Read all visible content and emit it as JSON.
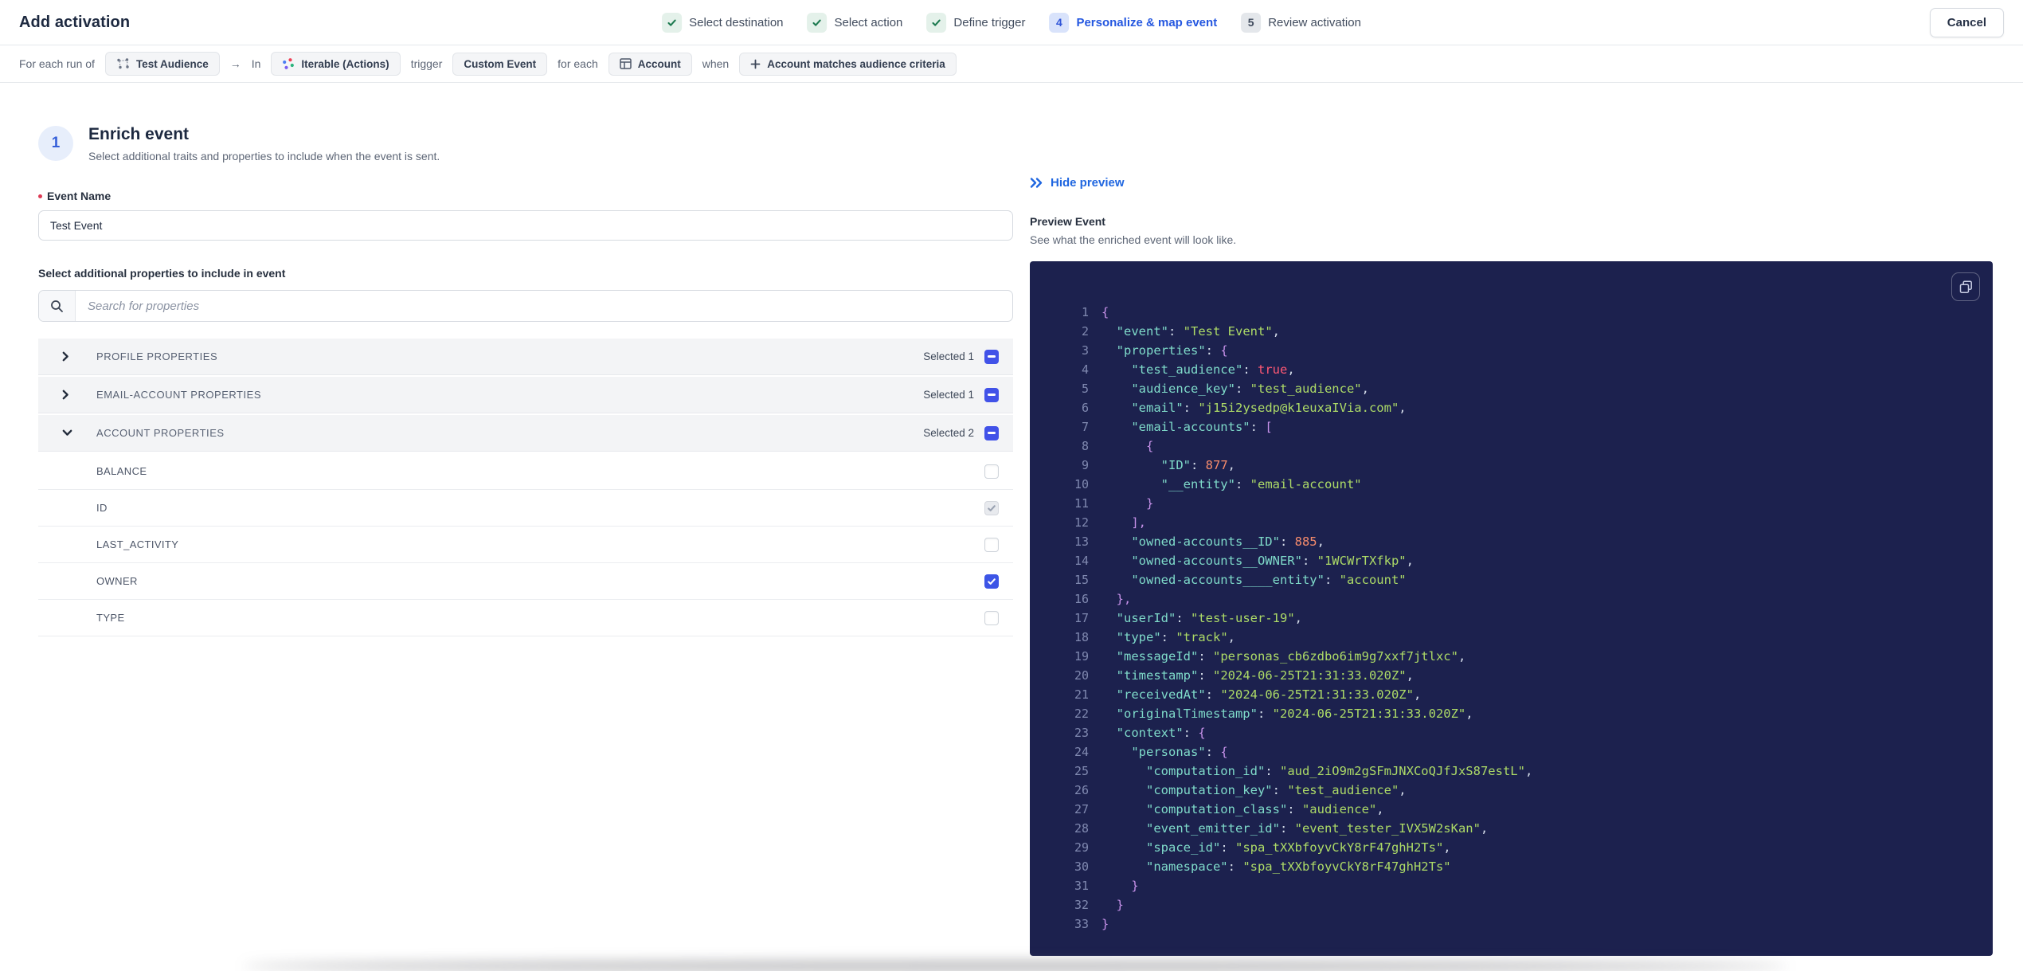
{
  "colors": {
    "accent_blue": "#2457e0",
    "checkbox_blue": "#3d55e6",
    "success_green": "#1d7a50",
    "code_background": "#1c214e",
    "code_key": "#7fdbca",
    "code_string": "#addb67",
    "code_number": "#f78c6c",
    "code_boolean": "#ff5874",
    "code_brace": "#c792ea"
  },
  "header": {
    "title": "Add activation",
    "cancel_label": "Cancel",
    "steps": [
      {
        "label": "Select destination",
        "state": "done",
        "icon": "check-icon"
      },
      {
        "label": "Select action",
        "state": "done",
        "icon": "check-icon"
      },
      {
        "label": "Define trigger",
        "state": "done",
        "icon": "check-icon"
      },
      {
        "label": "Personalize & map event",
        "state": "active",
        "number": "4"
      },
      {
        "label": "Review activation",
        "state": "upcoming",
        "number": "5"
      }
    ]
  },
  "summary": {
    "tokens": [
      {
        "type": "text",
        "text": "For each run of"
      },
      {
        "type": "chip",
        "text": "Test Audience",
        "icon": "audience-icon"
      },
      {
        "type": "text",
        "text": "→"
      },
      {
        "type": "text",
        "text": "In"
      },
      {
        "type": "chip",
        "text": "Iterable (Actions)",
        "icon": "iterable-icon"
      },
      {
        "type": "text",
        "text": "trigger"
      },
      {
        "type": "chip",
        "text": "Custom Event"
      },
      {
        "type": "text",
        "text": "for each"
      },
      {
        "type": "chip",
        "text": "Account",
        "icon": "table-icon"
      },
      {
        "type": "text",
        "text": "when"
      },
      {
        "type": "chip",
        "text": "Account matches audience criteria",
        "icon": "plus-icon"
      }
    ]
  },
  "enrich": {
    "step_number": "1",
    "title": "Enrich event",
    "subtitle": "Select additional traits and properties to include when the event is sent.",
    "event_name_label": "Event Name",
    "event_name_value": "Test Event",
    "properties_label": "Select additional properties to include in event",
    "search_placeholder": "Search for properties",
    "sections": [
      {
        "label": "PROFILE PROPERTIES",
        "selected_label": "Selected 1",
        "expanded": false,
        "rows": []
      },
      {
        "label": "EMAIL-ACCOUNT PROPERTIES",
        "selected_label": "Selected 1",
        "expanded": false,
        "rows": []
      },
      {
        "label": "ACCOUNT PROPERTIES",
        "selected_label": "Selected 2",
        "expanded": true,
        "rows": [
          {
            "label": "BALANCE",
            "checkbox": "unchecked"
          },
          {
            "label": "ID",
            "checkbox": "checked-disabled"
          },
          {
            "label": "LAST_ACTIVITY",
            "checkbox": "unchecked"
          },
          {
            "label": "OWNER",
            "checkbox": "checked"
          },
          {
            "label": "TYPE",
            "checkbox": "unchecked"
          }
        ]
      }
    ]
  },
  "preview": {
    "hide_label": "Hide preview",
    "title": "Preview Event",
    "subtitle": "See what the enriched event will look like.",
    "code_lines": [
      [
        [
          "brace",
          "{"
        ]
      ],
      [
        [
          "key",
          "  \"event\""
        ],
        [
          "punct",
          ": "
        ],
        [
          "str",
          "\"Test Event\""
        ],
        [
          "punct",
          ","
        ]
      ],
      [
        [
          "key",
          "  \"properties\""
        ],
        [
          "punct",
          ": "
        ],
        [
          "brace",
          "{"
        ]
      ],
      [
        [
          "key",
          "    \"test_audience\""
        ],
        [
          "punct",
          ": "
        ],
        [
          "bool",
          "true"
        ],
        [
          "punct",
          ","
        ]
      ],
      [
        [
          "key",
          "    \"audience_key\""
        ],
        [
          "punct",
          ": "
        ],
        [
          "str",
          "\"test_audience\""
        ],
        [
          "punct",
          ","
        ]
      ],
      [
        [
          "key",
          "    \"email\""
        ],
        [
          "punct",
          ": "
        ],
        [
          "str",
          "\"j15i2ysedp@k1euxaIVia.com\""
        ],
        [
          "punct",
          ","
        ]
      ],
      [
        [
          "key",
          "    \"email-accounts\""
        ],
        [
          "punct",
          ": "
        ],
        [
          "brace",
          "["
        ]
      ],
      [
        [
          "brace",
          "      {"
        ]
      ],
      [
        [
          "key",
          "        \"ID\""
        ],
        [
          "punct",
          ": "
        ],
        [
          "num",
          "877"
        ],
        [
          "punct",
          ","
        ]
      ],
      [
        [
          "key",
          "        \"__entity\""
        ],
        [
          "punct",
          ": "
        ],
        [
          "str",
          "\"email-account\""
        ]
      ],
      [
        [
          "brace",
          "      }"
        ]
      ],
      [
        [
          "brace",
          "    ],"
        ]
      ],
      [
        [
          "key",
          "    \"owned-accounts__ID\""
        ],
        [
          "punct",
          ": "
        ],
        [
          "num",
          "885"
        ],
        [
          "punct",
          ","
        ]
      ],
      [
        [
          "key",
          "    \"owned-accounts__OWNER\""
        ],
        [
          "punct",
          ": "
        ],
        [
          "str",
          "\"1WCWrTXfkp\""
        ],
        [
          "punct",
          ","
        ]
      ],
      [
        [
          "key",
          "    \"owned-accounts____entity\""
        ],
        [
          "punct",
          ": "
        ],
        [
          "str",
          "\"account\""
        ]
      ],
      [
        [
          "brace",
          "  },"
        ]
      ],
      [
        [
          "key",
          "  \"userId\""
        ],
        [
          "punct",
          ": "
        ],
        [
          "str",
          "\"test-user-19\""
        ],
        [
          "punct",
          ","
        ]
      ],
      [
        [
          "key",
          "  \"type\""
        ],
        [
          "punct",
          ": "
        ],
        [
          "str",
          "\"track\""
        ],
        [
          "punct",
          ","
        ]
      ],
      [
        [
          "key",
          "  \"messageId\""
        ],
        [
          "punct",
          ": "
        ],
        [
          "str",
          "\"personas_cb6zdbo6im9g7xxf7jtlxc\""
        ],
        [
          "punct",
          ","
        ]
      ],
      [
        [
          "key",
          "  \"timestamp\""
        ],
        [
          "punct",
          ": "
        ],
        [
          "str",
          "\"2024-06-25T21:31:33.020Z\""
        ],
        [
          "punct",
          ","
        ]
      ],
      [
        [
          "key",
          "  \"receivedAt\""
        ],
        [
          "punct",
          ": "
        ],
        [
          "str",
          "\"2024-06-25T21:31:33.020Z\""
        ],
        [
          "punct",
          ","
        ]
      ],
      [
        [
          "key",
          "  \"originalTimestamp\""
        ],
        [
          "punct",
          ": "
        ],
        [
          "str",
          "\"2024-06-25T21:31:33.020Z\""
        ],
        [
          "punct",
          ","
        ]
      ],
      [
        [
          "key",
          "  \"context\""
        ],
        [
          "punct",
          ": "
        ],
        [
          "brace",
          "{"
        ]
      ],
      [
        [
          "key",
          "    \"personas\""
        ],
        [
          "punct",
          ": "
        ],
        [
          "brace",
          "{"
        ]
      ],
      [
        [
          "key",
          "      \"computation_id\""
        ],
        [
          "punct",
          ": "
        ],
        [
          "str",
          "\"aud_2iO9m2gSFmJNXCoQJfJxS87estL\""
        ],
        [
          "punct",
          ","
        ]
      ],
      [
        [
          "key",
          "      \"computation_key\""
        ],
        [
          "punct",
          ": "
        ],
        [
          "str",
          "\"test_audience\""
        ],
        [
          "punct",
          ","
        ]
      ],
      [
        [
          "key",
          "      \"computation_class\""
        ],
        [
          "punct",
          ": "
        ],
        [
          "str",
          "\"audience\""
        ],
        [
          "punct",
          ","
        ]
      ],
      [
        [
          "key",
          "      \"event_emitter_id\""
        ],
        [
          "punct",
          ": "
        ],
        [
          "str",
          "\"event_tester_IVX5W2sKan\""
        ],
        [
          "punct",
          ","
        ]
      ],
      [
        [
          "key",
          "      \"space_id\""
        ],
        [
          "punct",
          ": "
        ],
        [
          "str",
          "\"spa_tXXbfoyvCkY8rF47ghH2Ts\""
        ],
        [
          "punct",
          ","
        ]
      ],
      [
        [
          "key",
          "      \"namespace\""
        ],
        [
          "punct",
          ": "
        ],
        [
          "str",
          "\"spa_tXXbfoyvCkY8rF47ghH2Ts\""
        ]
      ],
      [
        [
          "brace",
          "    }"
        ]
      ],
      [
        [
          "brace",
          "  }"
        ]
      ],
      [
        [
          "brace",
          "}"
        ]
      ]
    ]
  }
}
